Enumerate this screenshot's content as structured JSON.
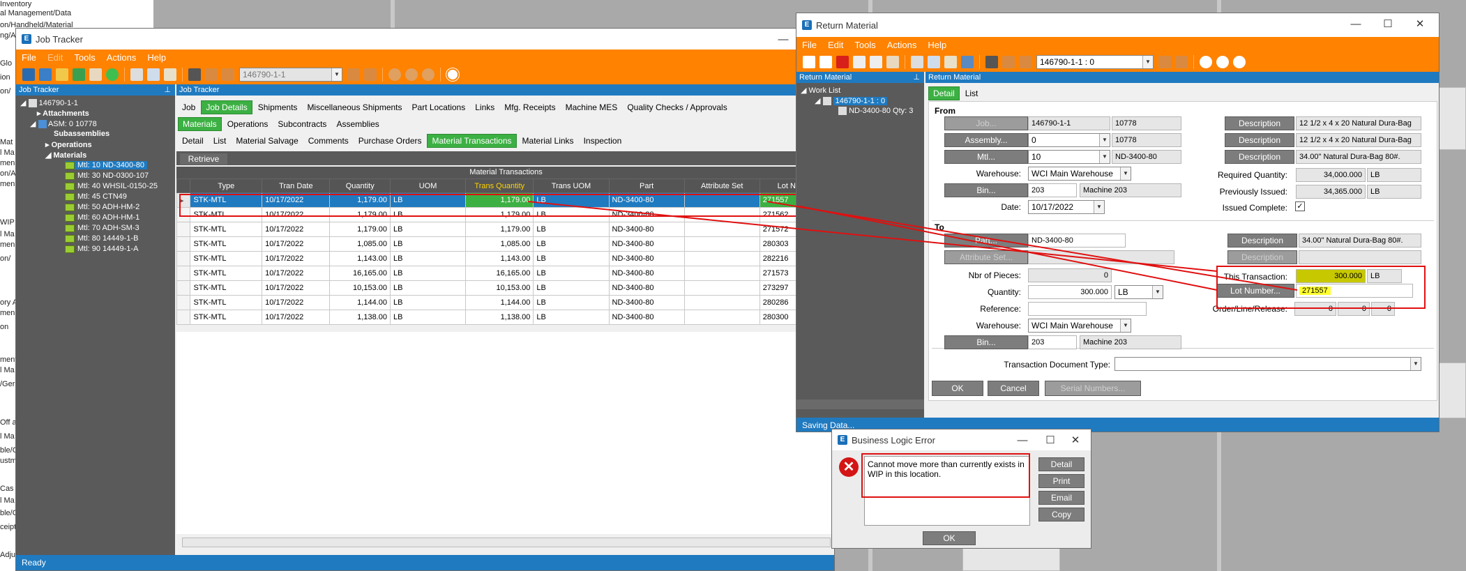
{
  "background": {
    "left_lines": [
      "Inventory",
      "al Management/Data",
      "on/Handheld/Material",
      "ng/Ad",
      "Glo",
      "ion",
      "on/",
      "Mat",
      "l Ma",
      "men",
      "on/A",
      "men",
      "WIP",
      "l Ma",
      "men",
      "on/",
      "ory A",
      "men",
      "on",
      "ment",
      "l Ma",
      "/Ger",
      "Off a",
      "l Ma",
      "ble/C",
      "ustm",
      "Cas",
      "l Ma",
      "ble/C",
      "ceipt",
      "Adju"
    ]
  },
  "job_tracker": {
    "title": "Job Tracker",
    "menu": [
      "File",
      "Edit",
      "Tools",
      "Actions",
      "Help"
    ],
    "job_combo": "146790-1-1",
    "left_panel_header": "Job Tracker",
    "main_panel_header": "Job Tracker",
    "tree": {
      "root": "146790-1-1",
      "attachments": "Attachments",
      "asm": "ASM: 0 10778",
      "subassemblies": "Subassemblies",
      "operations": "Operations",
      "materials": "Materials",
      "items": [
        "Mtl: 10 ND-3400-80",
        "Mtl: 30 ND-0300-107",
        "Mtl: 40 WHSIL-0150-25",
        "Mtl: 45 CTN49",
        "Mtl: 50 ADH-HM-2",
        "Mtl: 60 ADH-HM-1",
        "Mtl: 70 ADH-SM-3",
        "Mtl: 80 14449-1-B",
        "Mtl: 90 14449-1-A"
      ]
    },
    "tabs1": [
      "Job",
      "Job Details",
      "Shipments",
      "Miscellaneous Shipments",
      "Part Locations",
      "Links",
      "Mfg. Receipts",
      "Machine MES",
      "Quality Checks / Approvals"
    ],
    "tabs2": [
      "Materials",
      "Operations",
      "Subcontracts",
      "Assemblies"
    ],
    "tabs3": [
      "Detail",
      "List",
      "Material Salvage",
      "Comments",
      "Purchase Orders",
      "Material Transactions",
      "Material Links",
      "Inspection"
    ],
    "retrieve": "Retrieve",
    "grid_title": "Material Transactions",
    "columns": [
      "Type",
      "Tran Date",
      "Quantity",
      "UOM",
      "Trans Quantity",
      "Trans UOM",
      "Part",
      "Attribute Set",
      "Lot Number"
    ],
    "rows": [
      [
        "STK-MTL",
        "10/17/2022",
        "1,179.00",
        "LB",
        "1,179.00",
        "LB",
        "ND-3400-80",
        "",
        "271557"
      ],
      [
        "STK-MTL",
        "10/17/2022",
        "1,179.00",
        "LB",
        "1,179.00",
        "LB",
        "ND-3400-80",
        "",
        "271562"
      ],
      [
        "STK-MTL",
        "10/17/2022",
        "1,179.00",
        "LB",
        "1,179.00",
        "LB",
        "ND-3400-80",
        "",
        "271572"
      ],
      [
        "STK-MTL",
        "10/17/2022",
        "1,085.00",
        "LB",
        "1,085.00",
        "LB",
        "ND-3400-80",
        "",
        "280303"
      ],
      [
        "STK-MTL",
        "10/17/2022",
        "1,143.00",
        "LB",
        "1,143.00",
        "LB",
        "ND-3400-80",
        "",
        "282216"
      ],
      [
        "STK-MTL",
        "10/17/2022",
        "16,165.00",
        "LB",
        "16,165.00",
        "LB",
        "ND-3400-80",
        "",
        "271573"
      ],
      [
        "STK-MTL",
        "10/17/2022",
        "10,153.00",
        "LB",
        "10,153.00",
        "LB",
        "ND-3400-80",
        "",
        "273297"
      ],
      [
        "STK-MTL",
        "10/17/2022",
        "1,144.00",
        "LB",
        "1,144.00",
        "LB",
        "ND-3400-80",
        "",
        "280286"
      ],
      [
        "STK-MTL",
        "10/17/2022",
        "1,138.00",
        "LB",
        "1,138.00",
        "LB",
        "ND-3400-80",
        "",
        "280300"
      ]
    ],
    "status": "Ready"
  },
  "return_material": {
    "title": "Return Material",
    "menu": [
      "File",
      "Edit",
      "Tools",
      "Actions",
      "Help"
    ],
    "combo": "146790-1-1 : 0",
    "left_header": "Return Material",
    "main_header": "Return Material",
    "worklist": "Work List",
    "wl_item1": "146790-1-1 : 0",
    "wl_item2": "ND-3400-80 Qty: 3",
    "tabs": [
      "Detail",
      "List"
    ],
    "from_label": "From",
    "to_label": "To",
    "job_btn": "Job...",
    "job_val": "146790-1-1",
    "job_val2": "10778",
    "assembly_btn": "Assembly...",
    "assembly_val": "0",
    "assembly_val2": "10778",
    "mtl_btn": "Mtl...",
    "mtl_val": "10",
    "mtl_val2": "ND-3400-80",
    "warehouse_label": "Warehouse:",
    "warehouse_val": "WCI Main Warehouse",
    "bin_btn": "Bin...",
    "bin_val": "203",
    "bin_desc": "Machine 203",
    "date_label": "Date:",
    "date_val": "10/17/2022",
    "desc_btn": "Description",
    "desc1": "12 1/2 x 4 x 20 Natural Dura-Bag",
    "desc2": "12 1/2 x 4 x 20 Natural Dura-Bag",
    "desc3": "34.00\" Natural Dura-Bag 80#.",
    "req_qty_label": "Required Quantity:",
    "req_qty": "34,000.000",
    "req_uom": "LB",
    "prev_issued_label": "Previously Issued:",
    "prev_issued": "34,365.000",
    "prev_uom": "LB",
    "issued_complete_label": "Issued Complete:",
    "part_btn": "Part...",
    "part_val": "ND-3400-80",
    "attr_btn": "Attribute Set...",
    "to_desc_btn": "Description",
    "to_desc": "34.00\" Natural Dura-Bag 80#.",
    "to_desc_btn2": "Description",
    "nbr_pieces_label": "Nbr of Pieces:",
    "nbr_pieces": "0",
    "quantity_label": "Quantity:",
    "quantity": "300.000",
    "qty_uom": "LB",
    "reference_label": "Reference:",
    "to_warehouse_label": "Warehouse:",
    "to_warehouse": "WCI Main Warehouse",
    "to_bin_btn": "Bin...",
    "to_bin": "203",
    "to_bin_desc": "Machine 203",
    "this_trans_label": "This Transaction:",
    "this_trans": "300.000",
    "this_trans_uom": "LB",
    "lot_btn": "Lot Number...",
    "lot_val": "271557",
    "olr_label": "Order/Line/Release:",
    "olr": [
      "0",
      "0",
      "0"
    ],
    "tdt_label": "Transaction Document Type:",
    "ok": "OK",
    "cancel": "Cancel",
    "serial": "Serial Numbers...",
    "status": "Saving Data..."
  },
  "error_dialog": {
    "title": "Business Logic Error",
    "message": "Cannot move more than currently exists in WIP in this location.",
    "buttons": [
      "Detail",
      "Print",
      "Email",
      "Copy"
    ],
    "ok": "OK"
  },
  "colors": {
    "accent": "#ff8200",
    "header": "#1f7ac0",
    "active_tab": "#3cb043",
    "highlight": "#e01010"
  }
}
